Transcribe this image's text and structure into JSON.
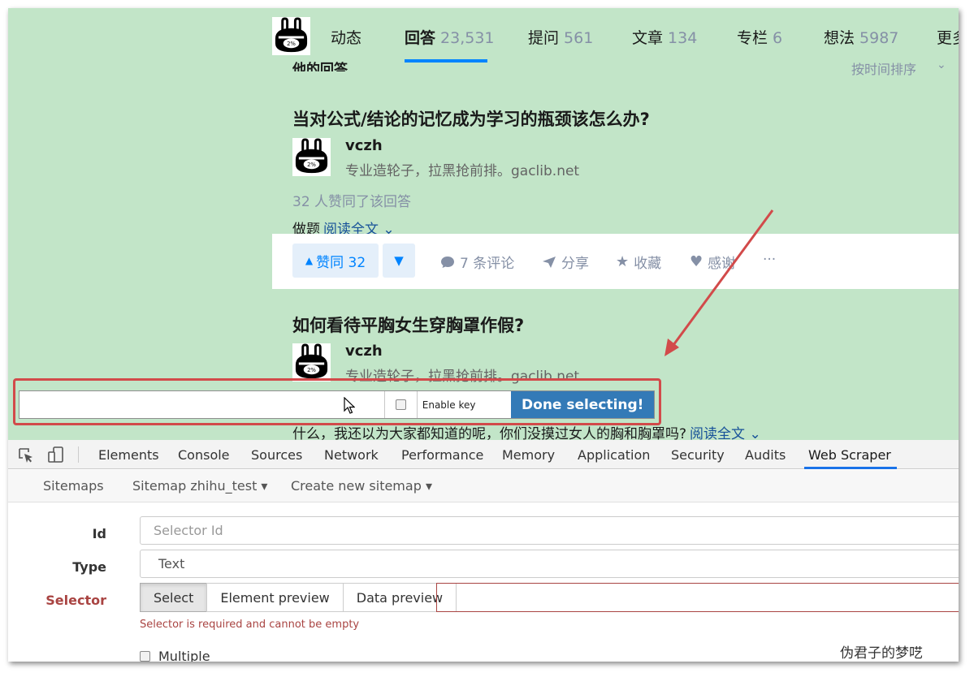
{
  "nav": {
    "items": [
      {
        "label": "动态",
        "count": ""
      },
      {
        "label": "回答",
        "count": "23,531"
      },
      {
        "label": "提问",
        "count": "561"
      },
      {
        "label": "文章",
        "count": "134"
      },
      {
        "label": "专栏",
        "count": "6"
      },
      {
        "label": "想法",
        "count": "5987"
      },
      {
        "label": "更多",
        "count": ""
      }
    ]
  },
  "section": {
    "title": "他的回答",
    "sort": "按时间排序"
  },
  "answers": [
    {
      "question": "当对公式/结论的记忆成为学习的瓶颈该怎么办?",
      "author": "vczh",
      "bio": "专业造轮子，拉黑抢前排。gaclib.net",
      "votes_text": "32 人赞同了该回答",
      "excerpt": "做题",
      "read_more": "阅读全文"
    },
    {
      "question": "如何看待平胸女生穿胸罩作假?",
      "author": "vczh",
      "bio": "专业造轮子，拉黑抢前排。gaclib.net",
      "excerpt": "什么，我还以为大家都知道的呢，你们没摸过女人的胸和胸罩吗?",
      "read_more": "阅读全文"
    }
  ],
  "actions": {
    "upvote": "赞同 32",
    "comments": "7 条评论",
    "share": "分享",
    "favorite": "收藏",
    "thanks": "感谢",
    "more": "···"
  },
  "scraper_bar": {
    "enable_key": "Enable key",
    "done": "Done selecting!"
  },
  "devtools": {
    "tabs": [
      "Elements",
      "Console",
      "Sources",
      "Network",
      "Performance",
      "Memory",
      "Application",
      "Security",
      "Audits",
      "Web Scraper"
    ],
    "active_tab": "Web Scraper"
  },
  "webscraper": {
    "nav": [
      "Sitemaps",
      "Sitemap zhihu_test ▾",
      "Create new sitemap ▾"
    ],
    "form": {
      "id_label": "Id",
      "id_placeholder": "Selector Id",
      "type_label": "Type",
      "type_value": "Text",
      "selector_label": "Selector",
      "buttons": [
        "Select",
        "Element preview",
        "Data preview"
      ],
      "error": "Selector is required and cannot be empty",
      "multiple_label": "Multiple"
    }
  },
  "watermark": "伪君子的梦呓",
  "colors": {
    "page_bg": "#c2e5c8",
    "zhihu_blue": "#0084ff",
    "link_blue": "#175199",
    "done_button": "#337ab7",
    "annotation_red": "#d24a4a",
    "error_red": "#a94442"
  }
}
